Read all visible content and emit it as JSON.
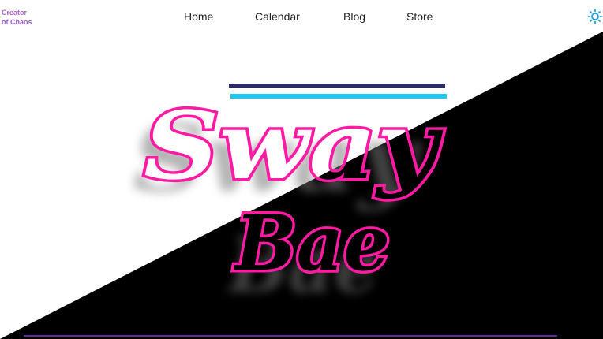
{
  "brand": {
    "line1": "Creator",
    "line2": "of Chaos"
  },
  "nav": {
    "items": [
      {
        "label": "Home"
      },
      {
        "label": "Calendar"
      },
      {
        "label": "Blog"
      },
      {
        "label": "Store"
      }
    ]
  },
  "hero": {
    "word1": "Sway",
    "word2": "Bae"
  },
  "colors": {
    "pink": "#ff1aa3",
    "navy": "#2a2a6e",
    "cyan": "#1ec8f0",
    "dark": "#000000",
    "toggle": "#1e9fe0"
  },
  "icons": {
    "theme_toggle": "sun-icon"
  }
}
